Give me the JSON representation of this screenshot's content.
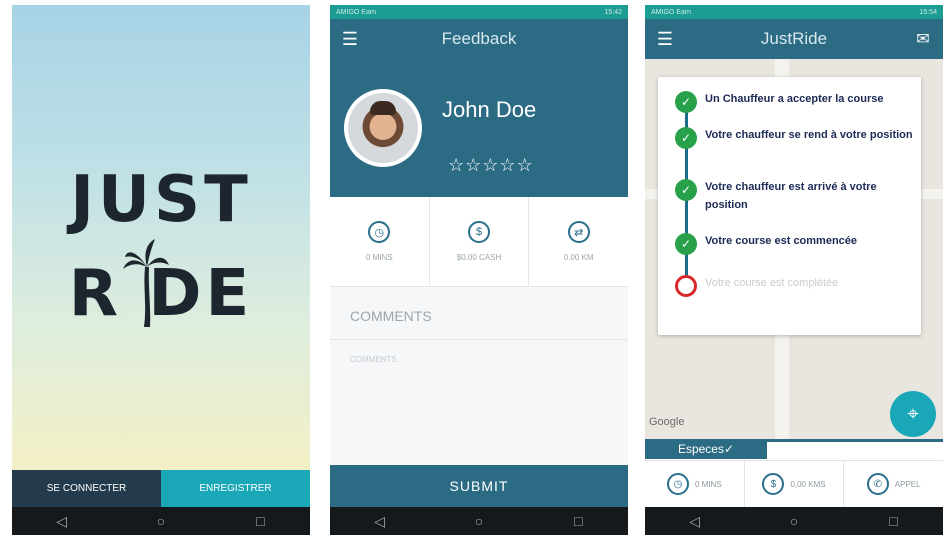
{
  "splash": {
    "logo_line1": "JUST",
    "logo_line2": "R DE",
    "login_label": "SE CONNECTER",
    "register_label": "ENREGISTRER"
  },
  "status_bar": {
    "operator": "AMIGO Earn",
    "time_2": "15:42",
    "time_3": "15:54"
  },
  "feedback": {
    "title": "Feedback",
    "driver_name": "John Doe",
    "rating_stars": 0,
    "stats": [
      {
        "icon": "clock-icon",
        "label": "0 MINS"
      },
      {
        "icon": "money-icon",
        "label": "$0.00 CASH"
      },
      {
        "icon": "distance-icon",
        "label": "0.00 KM"
      }
    ],
    "comments_heading": "COMMENTS",
    "comments_placeholder": "COMMENTS",
    "submit_label": "SUBMIT"
  },
  "ride": {
    "title": "JustRide",
    "steps": [
      {
        "text": "Un Chauffeur a accepter la course",
        "done": true
      },
      {
        "text": "Votre chauffeur se rend à votre position",
        "done": true
      },
      {
        "text": "Votre chauffeur est arrivé à votre position",
        "done": true
      },
      {
        "text": "Votre course est commencée",
        "done": true
      },
      {
        "text": "Votre course est complétée",
        "done": false
      }
    ],
    "payment_tab": "Especes",
    "google_label": "Google",
    "info": [
      {
        "icon": "clock-icon",
        "label": "0 MINS"
      },
      {
        "icon": "distance-icon",
        "label": "0,00 KMS"
      },
      {
        "icon": "phone-icon",
        "label": "APPEL"
      }
    ]
  },
  "colors": {
    "primary": "#2c6b84",
    "accent": "#1aa7b8",
    "status": "#1c9c93",
    "done": "#27a24a",
    "pending": "#d7272a"
  }
}
